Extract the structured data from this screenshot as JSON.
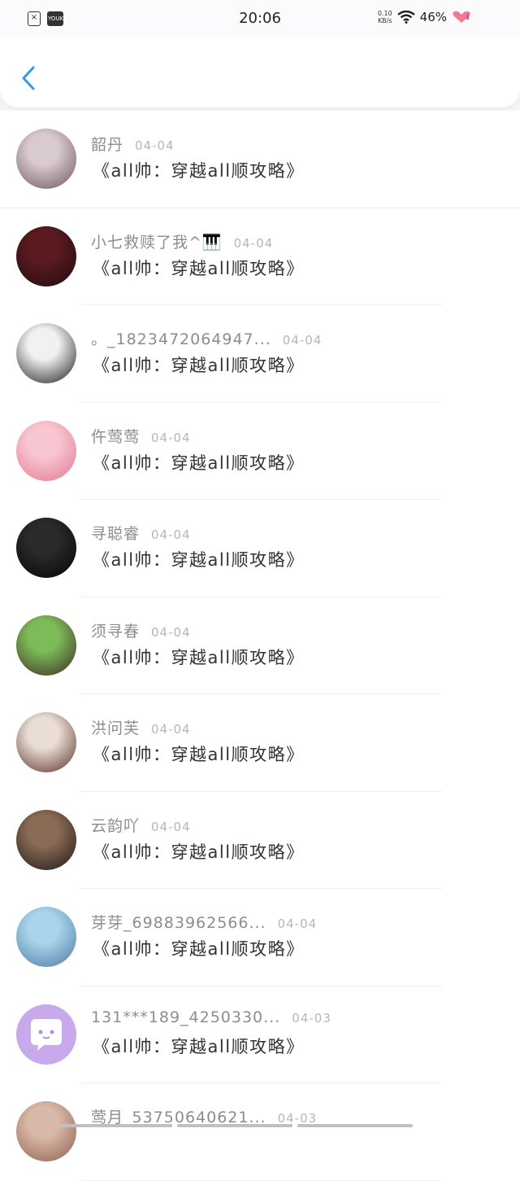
{
  "status_bar": {
    "time": "20:06",
    "net_speed_value": "0.10",
    "net_speed_unit": "KB/s",
    "battery": "46%",
    "left_icons": [
      "no-sim-icon",
      "youku-app-icon"
    ],
    "youku_label": "YOUKU",
    "icons": [
      "wifi-icon",
      "heart-battery-icon"
    ]
  },
  "header": {
    "back_icon": "chevron-left-icon",
    "accent": "#2f9bea"
  },
  "list": {
    "items": [
      {
        "name": "韶丹",
        "date": "04-04",
        "content": "《all帅：穿越all顺攻略》",
        "avatar_colors": [
          "#d9c9d0",
          "#6c5560"
        ]
      },
      {
        "name": "小七救赎了我^🎹",
        "date": "04-04",
        "content": "《all帅：穿越all顺攻略》",
        "avatar_colors": [
          "#5a1a1f",
          "#1c0d10"
        ]
      },
      {
        "name": "。_1823472064947...",
        "date": "04-04",
        "content": "《all帅：穿越all顺攻略》",
        "avatar_colors": [
          "#f1f1f1",
          "#1b1b1b"
        ]
      },
      {
        "name": "仵莺莺",
        "date": "04-04",
        "content": "《all帅：穿越all顺攻略》",
        "avatar_colors": [
          "#f7c6d1",
          "#e4788f"
        ]
      },
      {
        "name": "寻聪睿",
        "date": "04-04",
        "content": "《all帅：穿越all顺攻略》",
        "avatar_colors": [
          "#2a2a2a",
          "#050505"
        ]
      },
      {
        "name": "须寻春",
        "date": "04-04",
        "content": "《all帅：穿越all顺攻略》",
        "avatar_colors": [
          "#7dbb59",
          "#3e2a20"
        ]
      },
      {
        "name": "洪问芙",
        "date": "04-04",
        "content": "《all帅：穿越all顺攻略》",
        "avatar_colors": [
          "#e9ddd6",
          "#5a3025"
        ]
      },
      {
        "name": "云韵吖",
        "date": "04-04",
        "content": "《all帅：穿越all顺攻略》",
        "avatar_colors": [
          "#8a6b55",
          "#1d1714"
        ]
      },
      {
        "name": "芽芽_69883962566...",
        "date": "04-04",
        "content": "《all帅：穿越all顺攻略》",
        "avatar_colors": [
          "#a9d4ea",
          "#4d79a5"
        ]
      },
      {
        "name": "131***189_4250330...",
        "date": "04-03",
        "content": "《all帅：穿越all顺攻略》",
        "avatar_colors": [
          "#c7a9ec",
          "#b08ee0"
        ]
      },
      {
        "name": "莺月_53750640621...",
        "date": "04-03",
        "content": "",
        "avatar_colors": [
          "#d8b8a8",
          "#8e5e4e"
        ]
      }
    ]
  }
}
